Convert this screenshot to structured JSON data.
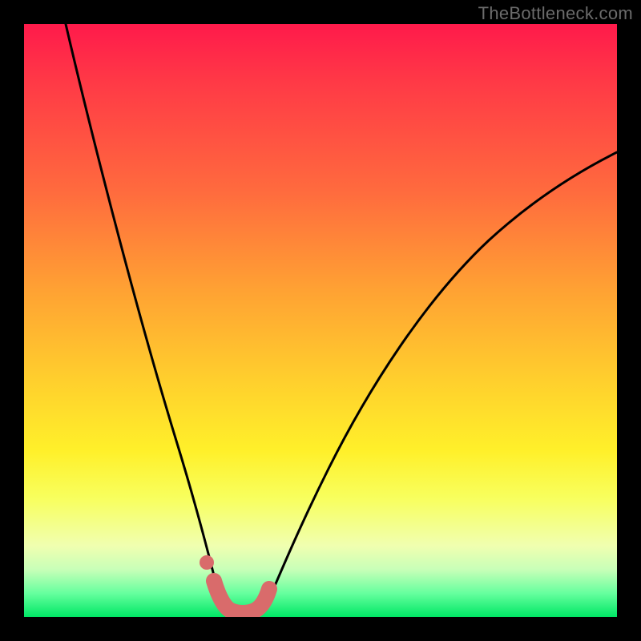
{
  "watermark": "TheBottleneck.com",
  "chart_data": {
    "type": "line",
    "title": "",
    "xlabel": "",
    "ylabel": "",
    "xlim": [
      0,
      100
    ],
    "ylim": [
      0,
      100
    ],
    "series": [
      {
        "name": "left-curve",
        "x": [
          7,
          10,
          14,
          18,
          22,
          25,
          27,
          29,
          30.5,
          31.5,
          32.5
        ],
        "y": [
          100,
          85,
          68,
          50,
          33,
          20,
          12,
          6,
          3,
          1.5,
          0.5
        ]
      },
      {
        "name": "right-curve",
        "x": [
          38,
          40,
          44,
          50,
          58,
          68,
          80,
          92,
          100
        ],
        "y": [
          0.5,
          3,
          10,
          22,
          37,
          52,
          65,
          74,
          79
        ]
      },
      {
        "name": "valley-floor",
        "x": [
          32.5,
          34,
          36,
          38
        ],
        "y": [
          0.5,
          0,
          0,
          0.5
        ]
      }
    ],
    "highlight": {
      "name": "optimal-range",
      "color": "#d96b6b",
      "x": [
        30,
        31,
        33,
        35,
        37,
        38.5
      ],
      "y": [
        6,
        2,
        0.5,
        0.5,
        0.8,
        2.5
      ]
    }
  }
}
